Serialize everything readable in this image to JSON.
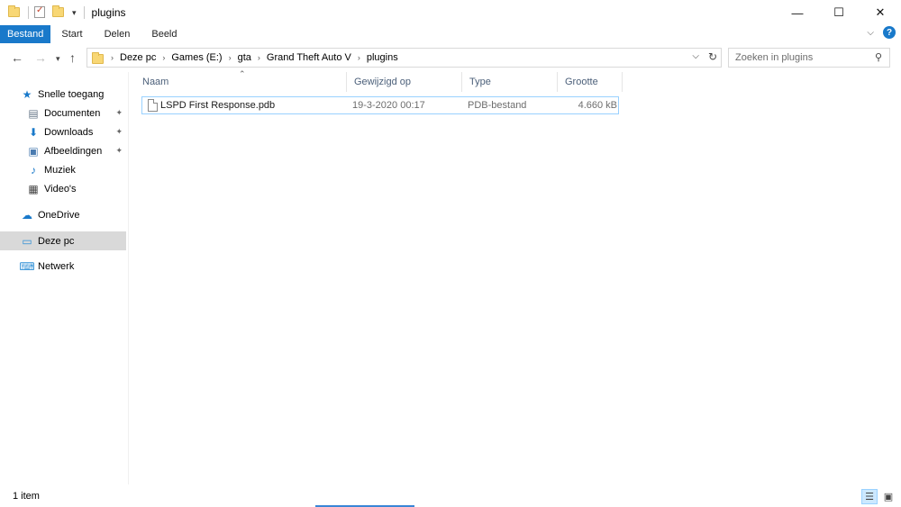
{
  "window": {
    "title": "plugins",
    "controls": {
      "minimize": "—",
      "maximize": "☐",
      "close": "✕"
    }
  },
  "ribbon": {
    "tabs": [
      "Bestand",
      "Start",
      "Delen",
      "Beeld"
    ],
    "collapse_glyph": "⌵",
    "help_glyph": "?"
  },
  "address": {
    "crumbs": [
      "Deze pc",
      "Games (E:)",
      "gta",
      "Grand Theft Auto V",
      "plugins"
    ],
    "separator": "›"
  },
  "search": {
    "placeholder": "Zoeken in plugins"
  },
  "nav_pane": {
    "items": [
      {
        "label": "Snelle toegang",
        "icon": "star-icon",
        "glyph": "★",
        "color": "#1979ca",
        "pinned": false
      },
      {
        "label": "Documenten",
        "icon": "documents-icon",
        "glyph": "▤",
        "color": "#6a7a8a",
        "pinned": true
      },
      {
        "label": "Downloads",
        "icon": "download-icon",
        "glyph": "⬇",
        "color": "#1979ca",
        "pinned": true
      },
      {
        "label": "Afbeeldingen",
        "icon": "pictures-icon",
        "glyph": "▣",
        "color": "#4a7bb0",
        "pinned": true
      },
      {
        "label": "Muziek",
        "icon": "music-icon",
        "glyph": "♪",
        "color": "#1979ca",
        "pinned": false
      },
      {
        "label": "Video's",
        "icon": "video-icon",
        "glyph": "▦",
        "color": "#444444",
        "pinned": false
      },
      {
        "label": "OneDrive",
        "icon": "onedrive-icon",
        "glyph": "☁",
        "color": "#1979ca",
        "pinned": false
      },
      {
        "label": "Deze pc",
        "icon": "computer-icon",
        "glyph": "▭",
        "color": "#2f8fd6",
        "pinned": false
      },
      {
        "label": "Netwerk",
        "icon": "network-icon",
        "glyph": "⌨",
        "color": "#2f8fd6",
        "pinned": false
      }
    ],
    "selected": "Deze pc",
    "pin_glyph": "📌"
  },
  "columns": [
    "Naam",
    "Gewijzigd op",
    "Type",
    "Grootte"
  ],
  "files": [
    {
      "name": "LSPD First Response.pdb",
      "modified": "19-3-2020 00:17",
      "type": "PDB-bestand",
      "size": "4.660 kB"
    }
  ],
  "status": {
    "item_count": "1 item"
  },
  "colors": {
    "accent": "#1979ca",
    "selection_border": "#99d1ff",
    "selected_nav": "#d9d9d9",
    "column_header": "#4c607a"
  }
}
